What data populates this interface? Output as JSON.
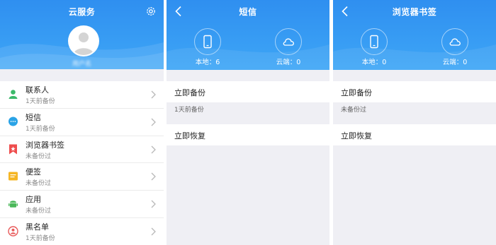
{
  "cloud_service": {
    "title": "云服务",
    "username": "用户名",
    "items": [
      {
        "label": "联系人",
        "status": "1天前备份",
        "icon": "contacts-icon",
        "color": "#3cb96a"
      },
      {
        "label": "短信",
        "status": "1天前备份",
        "icon": "sms-icon",
        "color": "#2aa3e6"
      },
      {
        "label": "浏览器书签",
        "status": "未备份过",
        "icon": "bookmark-icon",
        "color": "#ee4d4d"
      },
      {
        "label": "便签",
        "status": "未备份过",
        "icon": "notes-icon",
        "color": "#f5b523"
      },
      {
        "label": "应用",
        "status": "未备份过",
        "icon": "android-icon",
        "color": "#4bb85a"
      },
      {
        "label": "黑名单",
        "status": "1天前备份",
        "icon": "blacklist-icon",
        "color": "#e85a5a"
      }
    ]
  },
  "sms": {
    "title": "短信",
    "local_label": "本地：6",
    "cloud_label": "云端：0",
    "backup_label": "立即备份",
    "backup_status": "1天前备份",
    "restore_label": "立即恢复"
  },
  "bookmarks": {
    "title": "浏览器书签",
    "local_label": "本地：0",
    "cloud_label": "云端：0",
    "backup_label": "立即备份",
    "backup_status": "未备份过",
    "restore_label": "立即恢复"
  },
  "colors": {
    "header_blue": "#3a9df4",
    "background": "#efeff4"
  }
}
